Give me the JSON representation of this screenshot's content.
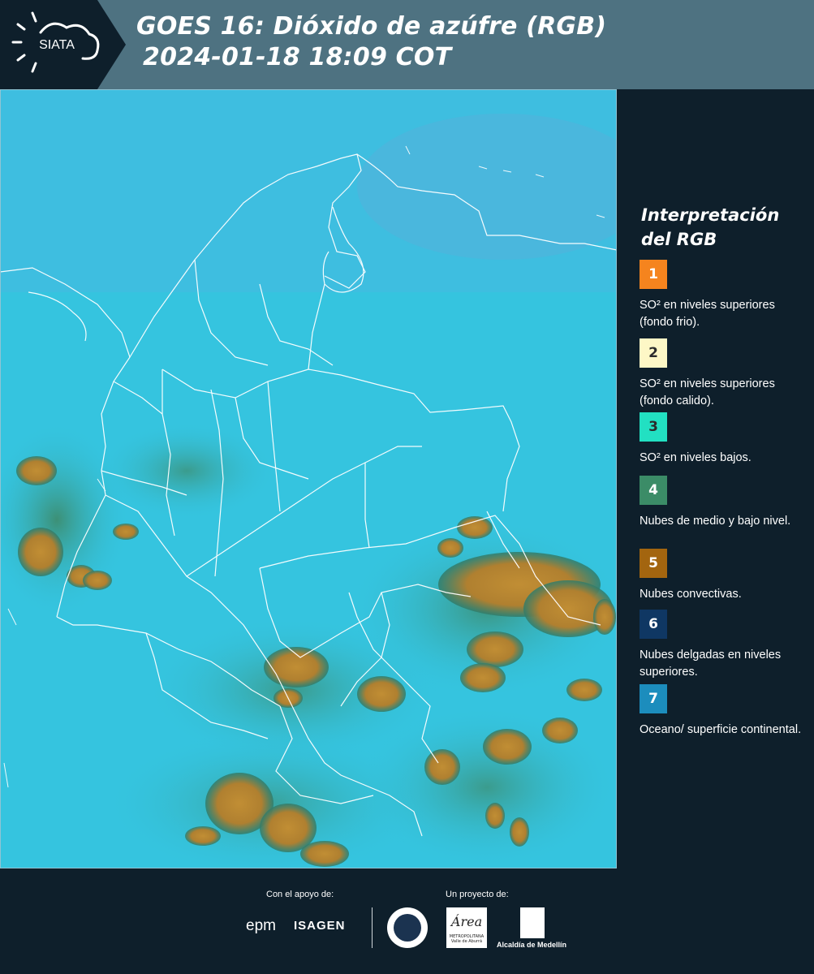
{
  "header": {
    "logo_text": "SIATA",
    "title_line1": "GOES 16: Dióxido de azúfre (RGB)",
    "title_line2": "2024-01-18 18:09 COT"
  },
  "map": {
    "background_color": "#33c3df",
    "border_color": "#ffffff",
    "convective_color": "#b5852f",
    "midlevel_color": "#3f8f6e"
  },
  "legend": {
    "title_line1": "Interpretación",
    "title_line2": "del RGB",
    "items": [
      {
        "number": "1",
        "color": "#f5841e",
        "text": "SO² en niveles superiores (fondo frio)."
      },
      {
        "number": "2",
        "color": "#fdf7c6",
        "text": "SO² en niveles superiores (fondo calido)."
      },
      {
        "number": "3",
        "color": "#22e0c2",
        "text": "SO² en niveles bajos."
      },
      {
        "number": "4",
        "color": "#3b8c67",
        "text": "Nubes de medio y bajo nivel."
      },
      {
        "number": "5",
        "color": "#a3650f",
        "text": "Nubes convectivas."
      },
      {
        "number": "6",
        "color": "#0f3763",
        "text": "Nubes delgadas en niveles superiores."
      },
      {
        "number": "7",
        "color": "#1c8dbd",
        "text": "Oceano/ superficie continental."
      }
    ]
  },
  "footer": {
    "support_label": "Con el apoyo de:",
    "project_label": "Un proyecto de:",
    "epm_text": "epm",
    "isagen_text": "ISAGEN",
    "area_text": "Área",
    "area_subtext": "METROPOLITANA Valle de Aburrá",
    "medellin_text": "Alcaldía de Medellín"
  }
}
